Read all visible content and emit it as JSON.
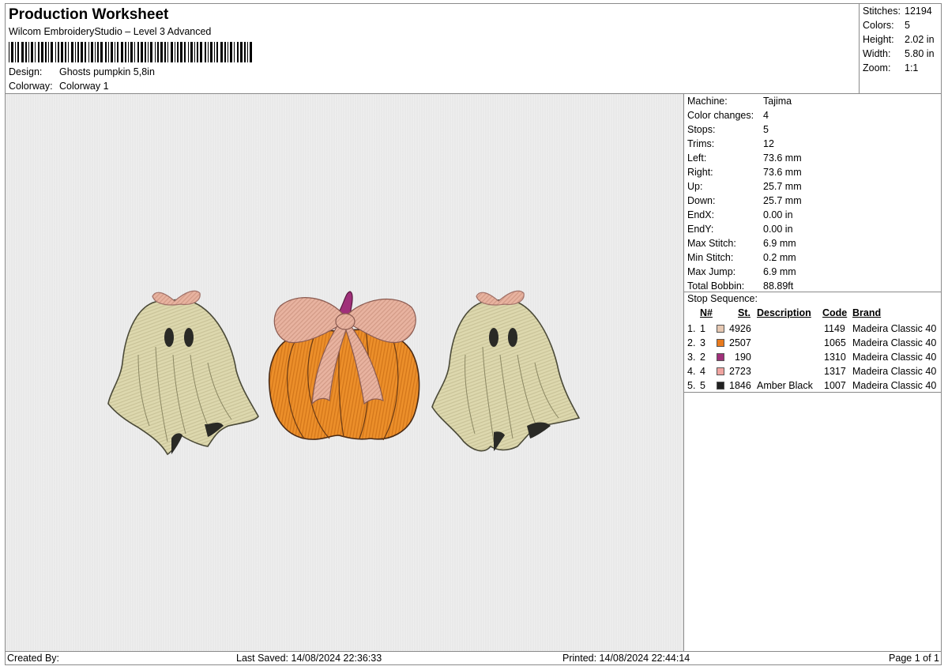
{
  "header": {
    "title": "Production Worksheet",
    "subtitle": "Wilcom EmbroideryStudio – Level 3 Advanced",
    "design_label": "Design:",
    "design_value": "Ghosts pumpkin 5,8in",
    "colorway_label": "Colorway:",
    "colorway_value": "Colorway 1"
  },
  "stats": [
    {
      "label": "Stitches:",
      "value": "12194"
    },
    {
      "label": "Colors:",
      "value": "5"
    },
    {
      "label": "Height:",
      "value": "2.02 in"
    },
    {
      "label": "Width:",
      "value": "5.80 in"
    },
    {
      "label": "Zoom:",
      "value": "1:1"
    }
  ],
  "machine_info": [
    {
      "label": "Machine:",
      "value": "Tajima"
    },
    {
      "label": "Color changes:",
      "value": "4"
    },
    {
      "label": "Stops:",
      "value": "5"
    },
    {
      "label": "Trims:",
      "value": "12"
    },
    {
      "label": "Left:",
      "value": "73.6 mm"
    },
    {
      "label": "Right:",
      "value": "73.6 mm"
    },
    {
      "label": "Up:",
      "value": "25.7 mm"
    },
    {
      "label": "Down:",
      "value": "25.7 mm"
    },
    {
      "label": "EndX:",
      "value": "0.00 in"
    },
    {
      "label": "EndY:",
      "value": "0.00 in"
    },
    {
      "label": "Max Stitch:",
      "value": "6.9 mm"
    },
    {
      "label": "Min Stitch:",
      "value": "0.2 mm"
    },
    {
      "label": "Max Jump:",
      "value": "6.9 mm"
    },
    {
      "label": "Total Bobbin:",
      "value": "88.89ft"
    }
  ],
  "stop_sequence": {
    "title": "Stop Sequence:",
    "headers": {
      "n": "N#",
      "st": "St.",
      "description": "Description",
      "code": "Code",
      "brand": "Brand"
    },
    "rows": [
      {
        "stop": "1.",
        "n": "1",
        "color": "#e6c8b2",
        "st": "4926",
        "description": "",
        "code": "1149",
        "brand": "Madeira Classic 40"
      },
      {
        "stop": "2.",
        "n": "3",
        "color": "#e87a1e",
        "st": "2507",
        "description": "",
        "code": "1065",
        "brand": "Madeira Classic 40"
      },
      {
        "stop": "3.",
        "n": "2",
        "color": "#a0307a",
        "st": "190",
        "description": "",
        "code": "1310",
        "brand": "Madeira Classic 40"
      },
      {
        "stop": "4.",
        "n": "4",
        "color": "#f0a4a0",
        "st": "2723",
        "description": "",
        "code": "1317",
        "brand": "Madeira Classic 40"
      },
      {
        "stop": "5.",
        "n": "5",
        "color": "#222222",
        "st": "1846",
        "description": "Amber Black",
        "code": "1007",
        "brand": "Madeira Classic 40"
      }
    ]
  },
  "footer": {
    "created_by": "Created By:",
    "last_saved": "Last Saved: 14/08/2024 22:36:33",
    "printed": "Printed: 14/08/2024 22:44:14",
    "page": "Page 1 of 1"
  }
}
